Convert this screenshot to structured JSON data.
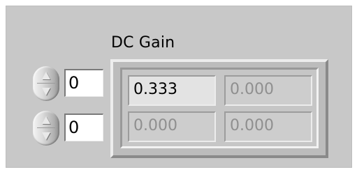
{
  "title": "DC Gain",
  "index_controls": [
    {
      "value": "0"
    },
    {
      "value": "0"
    }
  ],
  "matrix": {
    "rows": [
      [
        "0.333",
        "0.000"
      ],
      [
        "0.000",
        "0.000"
      ]
    ]
  },
  "colors": {
    "panel_bg": "#c8c8c8",
    "active_cell_bg": "#e3e3e3",
    "inactive_text": "#8f8f8f"
  }
}
